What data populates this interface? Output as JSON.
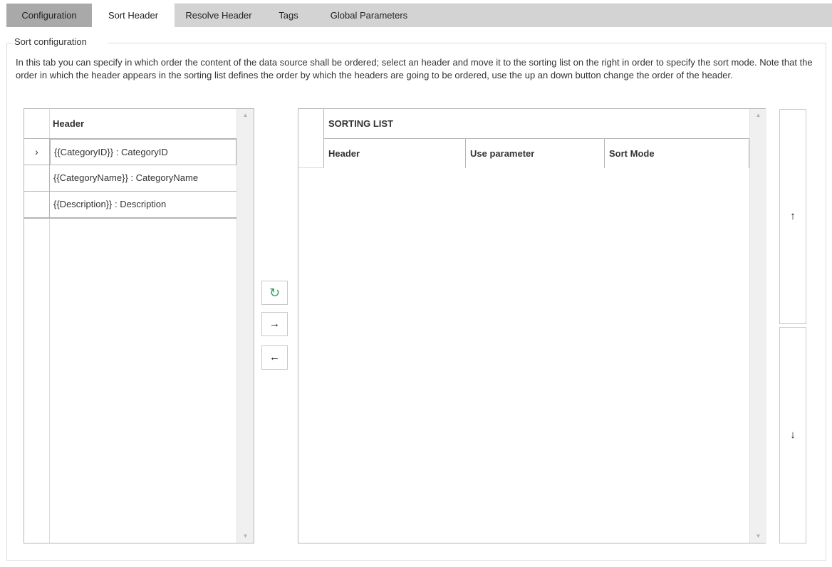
{
  "tabs": [
    {
      "label": "Configuration"
    },
    {
      "label": "Sort Header"
    },
    {
      "label": "Resolve Header"
    },
    {
      "label": "Tags"
    },
    {
      "label": "Global Parameters"
    }
  ],
  "group": {
    "title": "Sort configuration",
    "description": "In this tab you can specify in which order the content of the data source shall be ordered; select an header and move it to the sorting list on the right in order to specify the sort mode. Note that the order in which the header appears in the sorting list defines the order by which the headers are going to be ordered, use the up an down button change the order of the header."
  },
  "left_grid": {
    "column_header": "Header",
    "current_row_marker": "›",
    "rows": [
      {
        "value": "{{CategoryID}} : CategoryID"
      },
      {
        "value": "{{CategoryName}} : CategoryName"
      },
      {
        "value": "{{Description}} : Description"
      }
    ]
  },
  "middle_buttons": {
    "refresh_icon": "↻",
    "move_right_icon": "→",
    "move_left_icon": "←"
  },
  "right_grid": {
    "banner": "SORTING LIST",
    "columns": [
      "Header",
      "Use parameter",
      "Sort Mode"
    ]
  },
  "side_buttons": {
    "up_icon": "↑",
    "down_icon": "↓"
  },
  "scroll": {
    "up_arrow": "▲",
    "down_arrow": "▼"
  },
  "colors": {
    "tab_strip": "#d3d3d3",
    "tab_active_dark": "#a9a9a9",
    "refresh_green": "#3aa35c",
    "border": "#b5b5b5"
  }
}
